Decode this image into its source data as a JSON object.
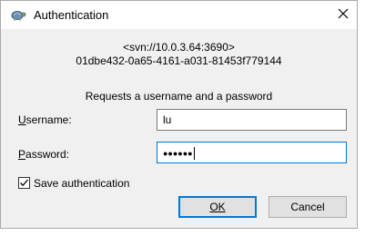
{
  "window": {
    "title": "Authentication",
    "icon": "tortoise-icon",
    "close_icon": "close-icon"
  },
  "repository": {
    "url": "<svn://10.0.3.64:3690>",
    "uuid": "01dbe432-0a65-4161-a031-81453f779144"
  },
  "prompt": "Requests a username and a password",
  "form": {
    "username_label_first": "U",
    "username_label_rest": "sername:",
    "username_value": "lu",
    "password_label_first": "P",
    "password_label_rest": "assword:",
    "password_masked": "●●●●●●"
  },
  "save_auth": {
    "label": "Save authentication",
    "checked": true
  },
  "buttons": {
    "ok_label": "OK",
    "cancel_label": "Cancel"
  },
  "colors": {
    "focus_border": "#0078d7",
    "dialog_bg": "#f0f0f0"
  }
}
